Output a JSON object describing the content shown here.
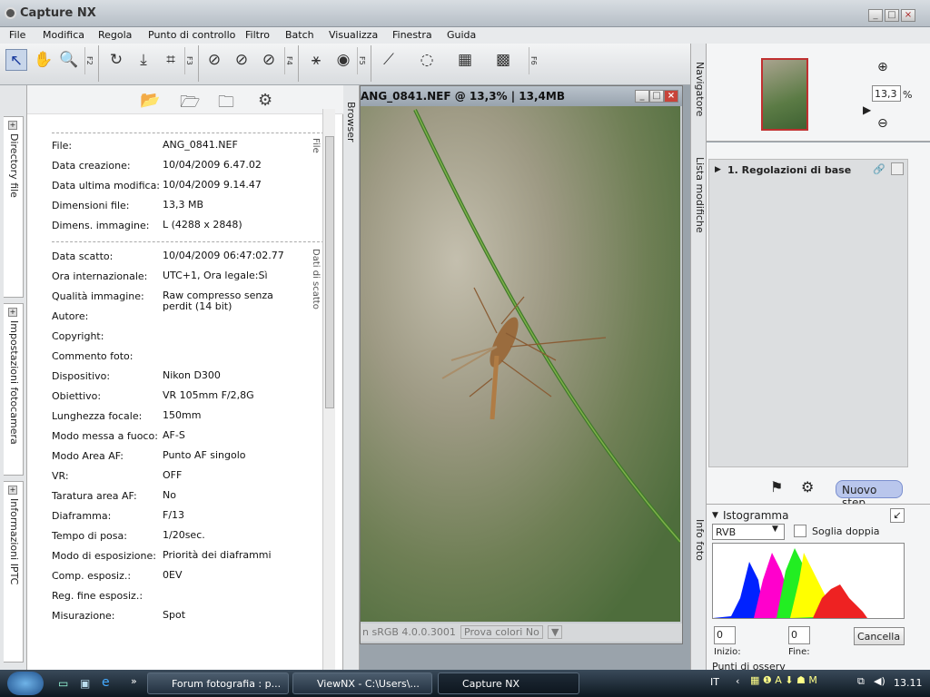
{
  "app": {
    "title": "Capture NX",
    "window_buttons": [
      "_",
      "□",
      "×"
    ]
  },
  "menu": [
    "File",
    "Modifica",
    "Regola",
    "Punto di controllo",
    "Filtro",
    "Batch",
    "Visualizza",
    "Finestra",
    "Guida"
  ],
  "toolbar": {
    "sections": [
      "F2",
      "F3",
      "F4",
      "F5",
      "F6"
    ]
  },
  "left_tabs": [
    "Directory file",
    "Impostazioni fotocamera",
    "Informazioni IPTC"
  ],
  "file_panel": {
    "side_labels": [
      "File",
      "Dati di scatto"
    ],
    "file_rows": [
      {
        "k": "File:",
        "v": "ANG_0841.NEF"
      },
      {
        "k": "Data creazione:",
        "v": "10/04/2009 6.47.02"
      },
      {
        "k": "Data ultima modifica:",
        "v": "10/04/2009 9.14.47"
      },
      {
        "k": "Dimensioni file:",
        "v": "13,3 MB"
      },
      {
        "k": "Dimens. immagine:",
        "v": "L (4288 x 2848)"
      }
    ],
    "shot_rows": [
      {
        "k": "Data scatto:",
        "v": "10/04/2009 06:47:02.77"
      },
      {
        "k": "Ora internazionale:",
        "v": "UTC+1, Ora legale:Sì"
      },
      {
        "k": "Qualità immagine:",
        "v": "Raw compresso senza perdit (14 bit)"
      },
      {
        "k": "Autore:",
        "v": ""
      },
      {
        "k": "Copyright:",
        "v": ""
      },
      {
        "k": "Commento foto:",
        "v": ""
      },
      {
        "k": "Dispositivo:",
        "v": "Nikon D300"
      },
      {
        "k": "Obiettivo:",
        "v": "VR 105mm F/2,8G"
      },
      {
        "k": "Lunghezza focale:",
        "v": "150mm"
      },
      {
        "k": "Modo messa a fuoco:",
        "v": "AF-S"
      },
      {
        "k": "Modo Area AF:",
        "v": "Punto AF singolo"
      },
      {
        "k": "VR:",
        "v": "OFF"
      },
      {
        "k": "Taratura area AF:",
        "v": "No"
      },
      {
        "k": "Diaframma:",
        "v": "F/13"
      },
      {
        "k": "Tempo di posa:",
        "v": "1/20sec."
      },
      {
        "k": "Modo di esposizione:",
        "v": "Priorità dei diaframmi"
      },
      {
        "k": "Comp. esposiz.:",
        "v": "0EV"
      },
      {
        "k": "Reg. fine esposiz.:",
        "v": ""
      },
      {
        "k": "Misurazione:",
        "v": "Spot"
      }
    ]
  },
  "browser_tab": "Browser",
  "image_window": {
    "title": "ANG_0841.NEF @ 13,3% | 13,4MB",
    "profile": "n sRGB 4.0.0.3001",
    "proof": "Prova colori No"
  },
  "navigator": {
    "label": "Navigatore",
    "zoom": "13,3",
    "unit": "%"
  },
  "changes": {
    "label": "Lista modifiche",
    "step": "1. Regolazioni di base",
    "new_step": "Nuovo step"
  },
  "info": {
    "label": "Info foto",
    "histogram": "Istogramma",
    "channel": "RVB",
    "double_threshold": "Soglia doppia",
    "start_value": "0",
    "end_value": "0",
    "start_label": "Inizio:",
    "end_label": "Fine:",
    "cancel": "Cancella",
    "next_panel": "Punti di osserv"
  },
  "taskbar": {
    "tasks": [
      "Forum fotografia : p...",
      "ViewNX - C:\\Users\\...",
      "Capture NX"
    ],
    "lang": "IT",
    "clock": "13.11"
  }
}
